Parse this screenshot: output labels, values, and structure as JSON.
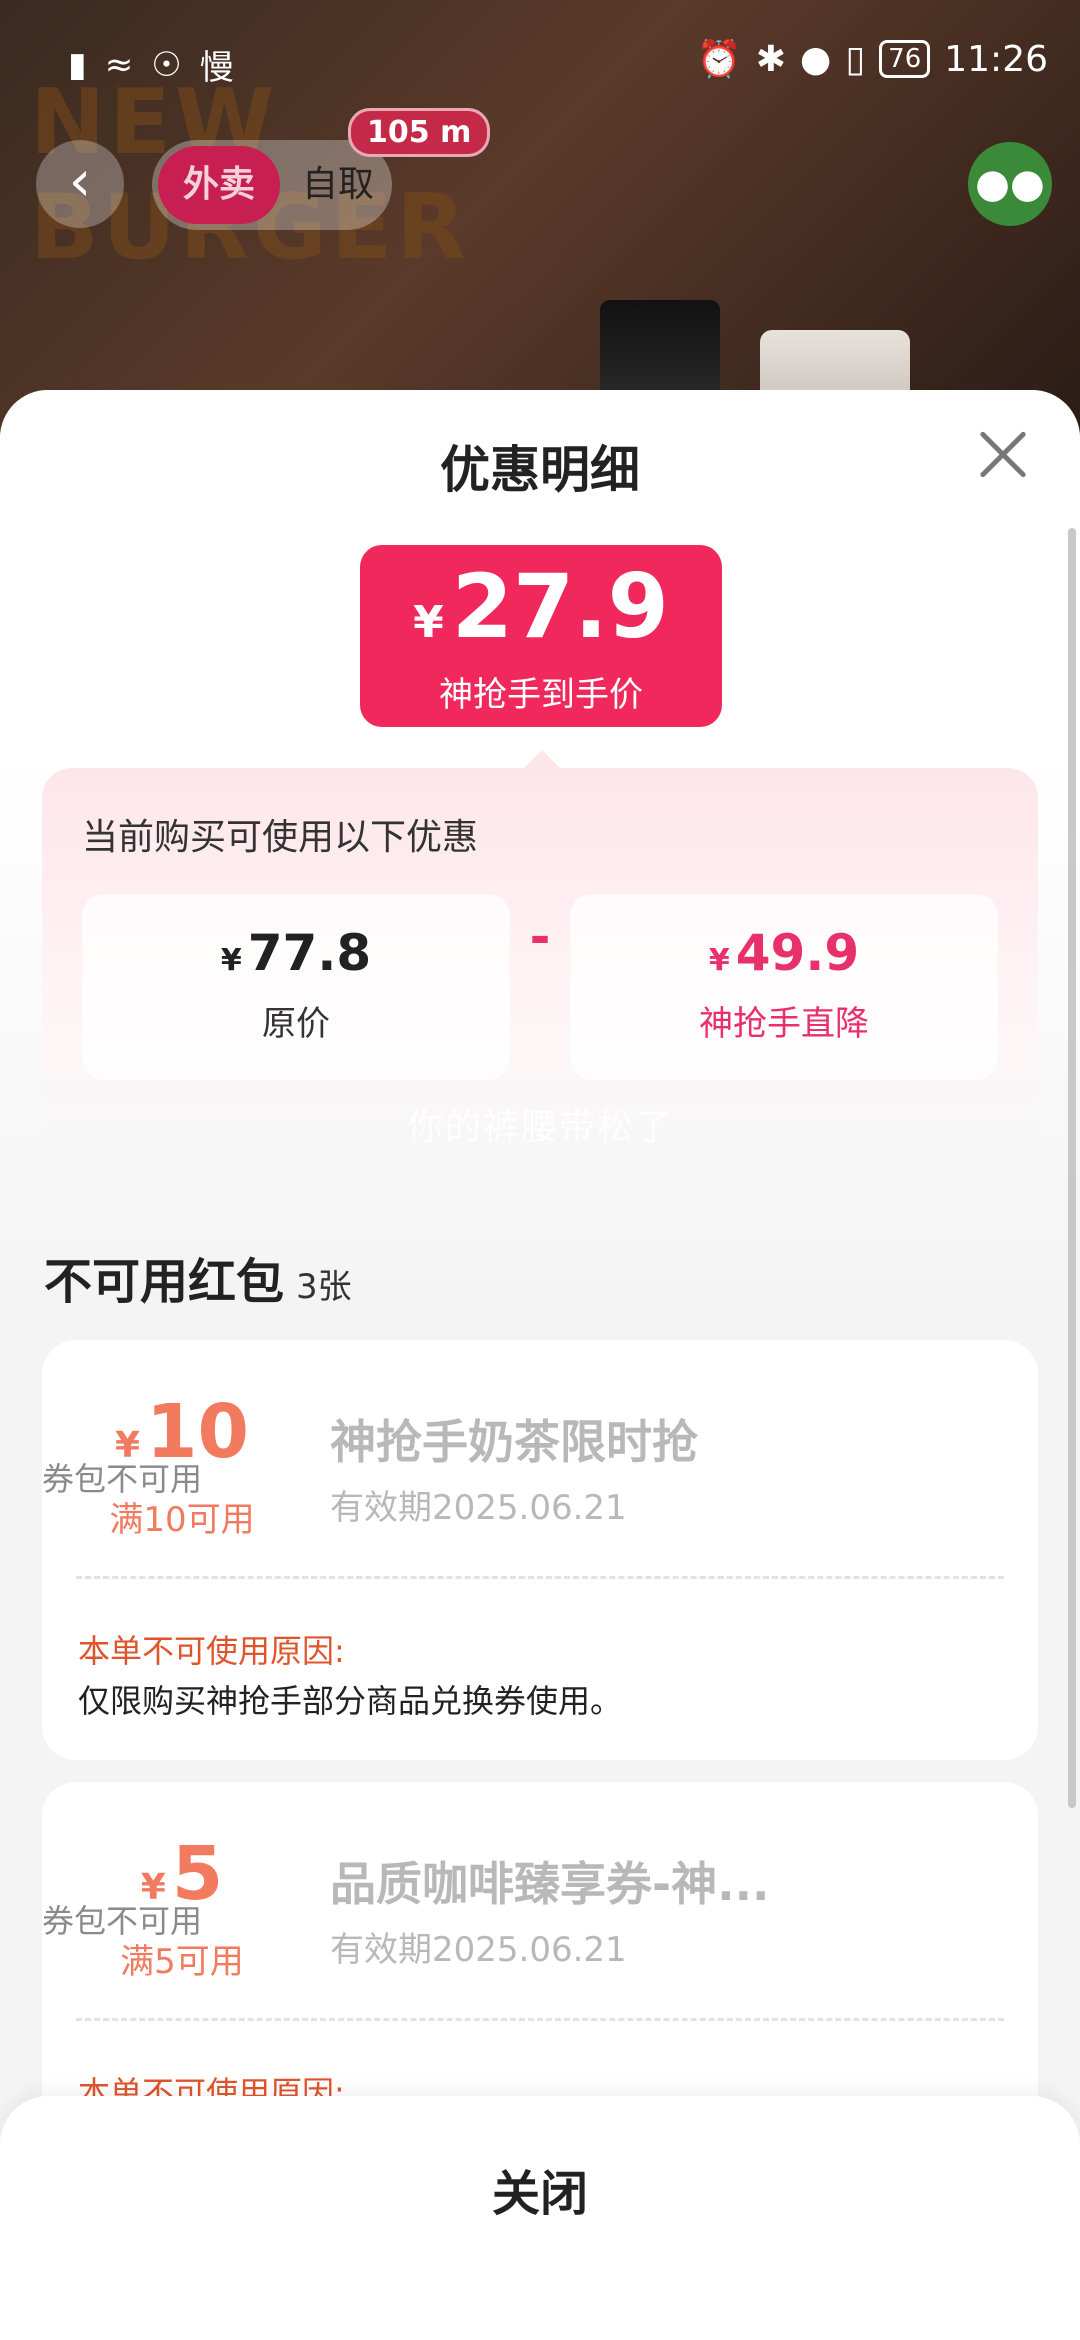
{
  "status_bar": {
    "left_icons": [
      "notification-alert-icon",
      "wifi-icon",
      "vpn-shield-icon"
    ],
    "left_text": "慢",
    "battery": "76",
    "time": "11:26"
  },
  "header": {
    "mode_active": "外卖",
    "mode_inactive": "自取",
    "distance": "105 m"
  },
  "sheet": {
    "title": "优惠明细",
    "price": {
      "currency": "¥",
      "amount": "27.9",
      "label": "神抢手到手价"
    },
    "breakdown": {
      "title": "当前购买可使用以下优惠",
      "original": {
        "currency": "¥",
        "amount": "77.8",
        "label": "原价"
      },
      "operator": "-",
      "discount": {
        "currency": "¥",
        "amount": "49.9",
        "label": "神抢手直降"
      }
    },
    "watermark": "你的裤腰带松了",
    "unavailable": {
      "title": "不可用红包",
      "count": "3张",
      "coupons": [
        {
          "currency": "¥",
          "amount": "10",
          "condition": "满10可用",
          "name": "神抢手奶茶限时抢",
          "validity": "有效期2025.06.21",
          "status": "券包不可用",
          "reason_title": "本单不可使用原因:",
          "reason": "仅限购买神抢手部分商品兑换券使用。"
        },
        {
          "currency": "¥",
          "amount": "5",
          "condition": "满5可用",
          "name": "品质咖啡臻享券-神...",
          "validity": "有效期2025.06.21",
          "status": "券包不可用",
          "reason_title": "本单不可使用原因:",
          "reason": ""
        }
      ]
    }
  },
  "bottom_bar": {
    "close_label": "关闭"
  },
  "colors": {
    "accent": "#f0285c",
    "coupon_amount": "#f27a5f",
    "reason": "#e0542c"
  }
}
